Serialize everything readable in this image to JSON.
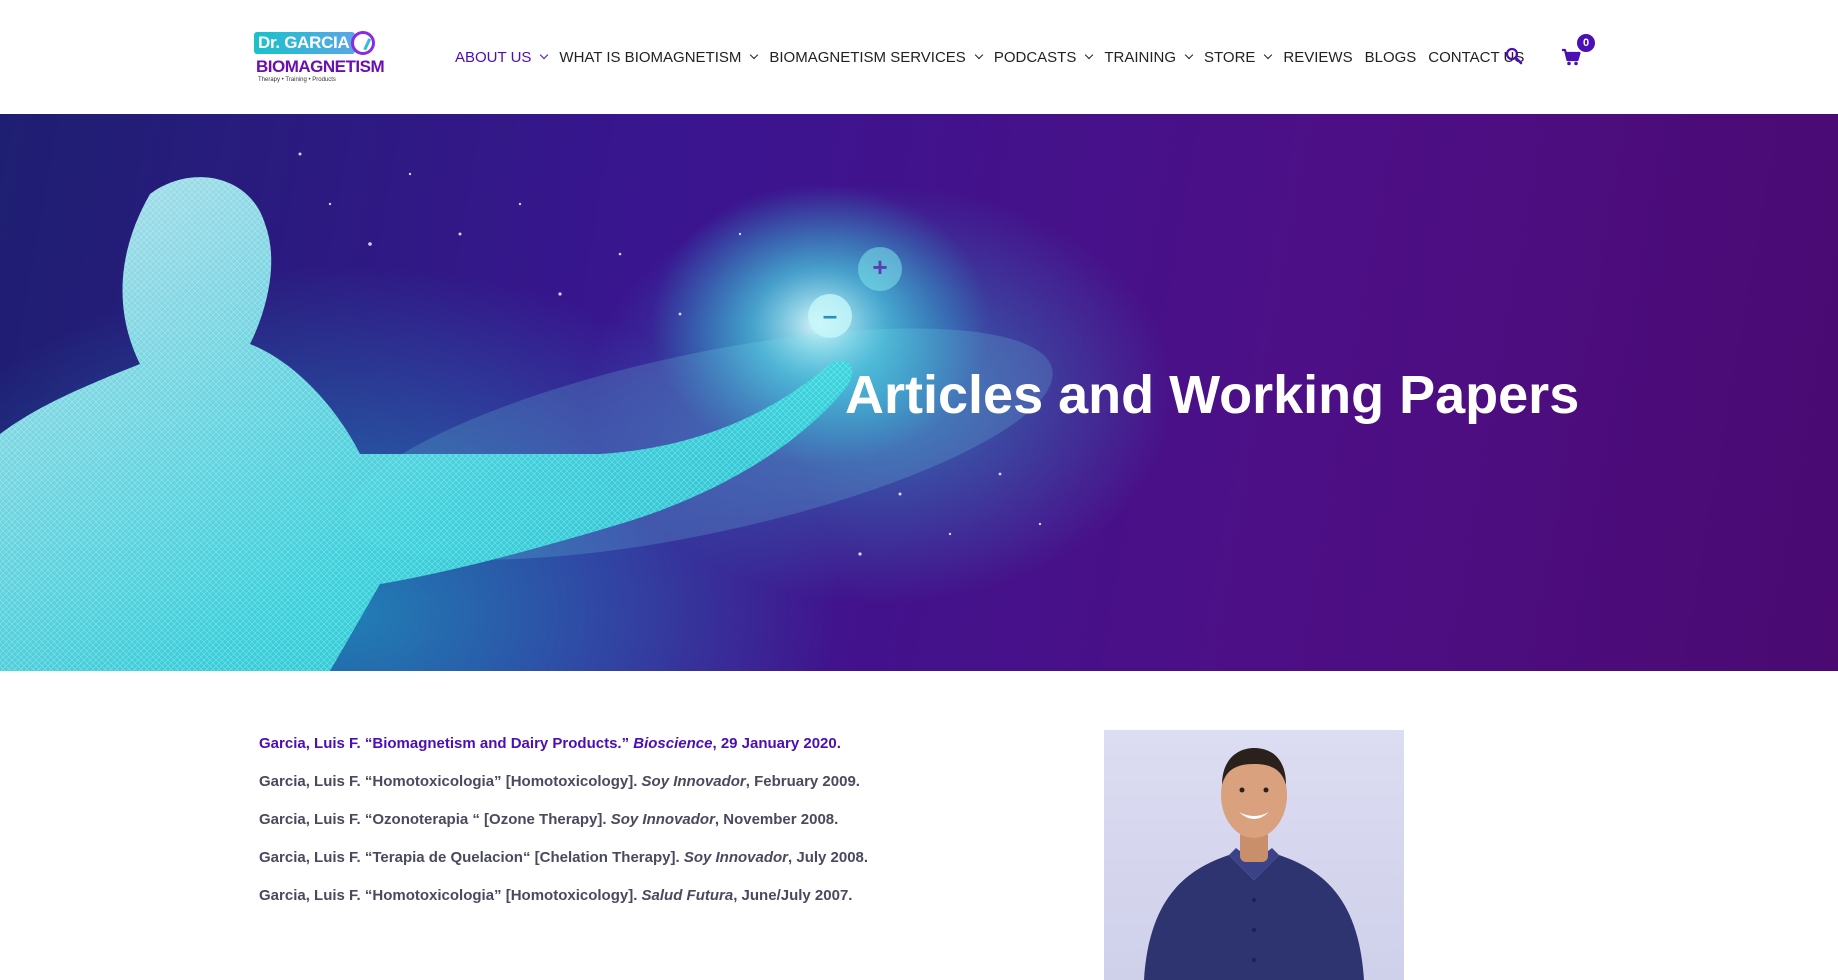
{
  "brand": {
    "logo_top": "Dr. GARCIA",
    "logo_main": "BIOMAGNETISM",
    "logo_tagline": "Therapy • Training • Products"
  },
  "nav": {
    "items": [
      {
        "label": "ABOUT US",
        "dropdown": true,
        "active": true
      },
      {
        "label": "WHAT IS BIOMAGNETISM",
        "dropdown": true
      },
      {
        "label": "BIOMAGNETISM SERVICES",
        "dropdown": true
      },
      {
        "label": "PODCASTS",
        "dropdown": true
      },
      {
        "label": "TRAINING",
        "dropdown": true
      },
      {
        "label": "STORE",
        "dropdown": true
      },
      {
        "label": "REVIEWS",
        "dropdown": false
      },
      {
        "label": "BLOGS",
        "dropdown": false
      },
      {
        "label": "CONTACT US",
        "dropdown": false
      }
    ],
    "cart_count": "0"
  },
  "hero": {
    "title": "Articles and Working Papers"
  },
  "articles": [
    {
      "prefix": "Garcia, Luis F. “Biomagnetism and Dairy Products.” ",
      "source": "Bioscience",
      "date": ", 29 January 2020."
    },
    {
      "prefix": "Garcia, Luis F. “Homotoxicologia” [Homotoxicology]. ",
      "source": "Soy Innovador",
      "date": ", February 2009."
    },
    {
      "prefix": "Garcia, Luis F. “Ozonoterapia “ [Ozone Therapy]. ",
      "source": "Soy Innovador",
      "date": ", November 2008."
    },
    {
      "prefix": "Garcia, Luis F. “Terapia de Quelacion“ [Chelation Therapy]. ",
      "source": "Soy Innovador",
      "date": ", July 2008."
    },
    {
      "prefix": "Garcia, Luis F. “Homotoxicologia” [Homotoxicology]. ",
      "source": "Salud Futura",
      "date": ", June/July 2007."
    }
  ],
  "colors": {
    "accent": "#4b0fb5",
    "text": "#4a4a5e",
    "hero_purple": "#4d0f86",
    "hero_cyan": "#29c1d6"
  },
  "icons": {
    "search": "search-icon",
    "cart": "cart-icon"
  }
}
